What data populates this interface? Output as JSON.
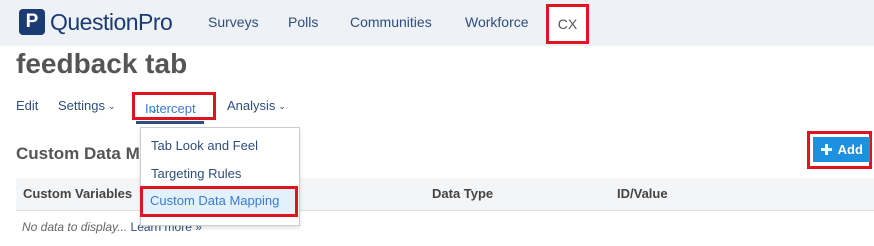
{
  "brand": {
    "logo_letter": "P",
    "name": "QuestionPro",
    "color": "#1a3b73"
  },
  "topnav": {
    "surveys": "Surveys",
    "polls": "Polls",
    "communities": "Communities",
    "workforce": "Workforce",
    "cx": "CX"
  },
  "page": {
    "title": "feedback tab"
  },
  "subnav": {
    "edit": "Edit",
    "settings": "Settings",
    "intercept": "Intercept",
    "analysis": "Analysis"
  },
  "intercept_menu": {
    "items": [
      "Tab Look and Feel",
      "Targeting Rules",
      "Custom Data Mapping"
    ],
    "selected": "Custom Data Mapping"
  },
  "section": {
    "title": "Custom Data Ma"
  },
  "actions": {
    "add_label": "Add",
    "add_color": "#1e90e0"
  },
  "table": {
    "columns": [
      "Custom Variables",
      "Data Type",
      "ID/Value"
    ],
    "empty_text": "No data to display...",
    "learn_more": "Learn more »"
  },
  "highlight_color": "#e0141e"
}
